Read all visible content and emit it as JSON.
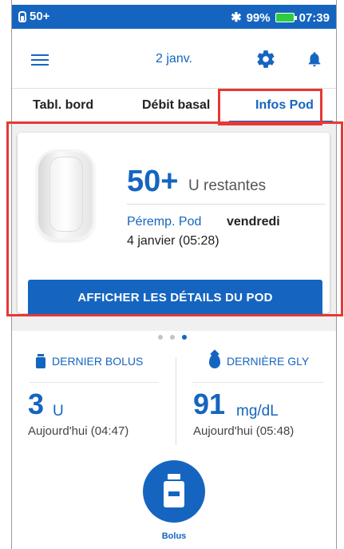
{
  "status_bar": {
    "pod_insulin": "50+",
    "bluetooth_icon": "bluetooth-icon",
    "battery_percent": "99%",
    "battery_color": "#2ecc40",
    "time": "07:39"
  },
  "header": {
    "menu_icon": "hamburger-menu-icon",
    "date": "2 janv.",
    "settings_icon": "gear-icon",
    "notifications_icon": "bell-icon"
  },
  "tabs": [
    {
      "label": "Tabl. bord",
      "active": false
    },
    {
      "label": "Débit basal",
      "active": false
    },
    {
      "label": "Infos Pod",
      "active": true
    }
  ],
  "pod_card": {
    "units_value": "50+",
    "units_label": "U restantes",
    "expiry_label": "Péremp. Pod",
    "expiry_day": "vendredi",
    "expiry_date": "4 janvier (05:28)",
    "details_button": "AFFICHER LES DÉTAILS DU POD"
  },
  "pager": {
    "count": 3,
    "active_index": 2
  },
  "last_bolus": {
    "title": "DERNIER BOLUS",
    "value": "3",
    "unit": "U",
    "time": "Aujourd'hui (04:47)"
  },
  "last_glucose": {
    "title": "DERNIÈRE GLY",
    "value": "91",
    "unit": "mg/dL",
    "time": "Aujourd'hui (05:48)"
  },
  "bolus_button": {
    "label": "Bolus"
  },
  "colors": {
    "accent": "#1565c0",
    "highlight": "#e53935"
  }
}
